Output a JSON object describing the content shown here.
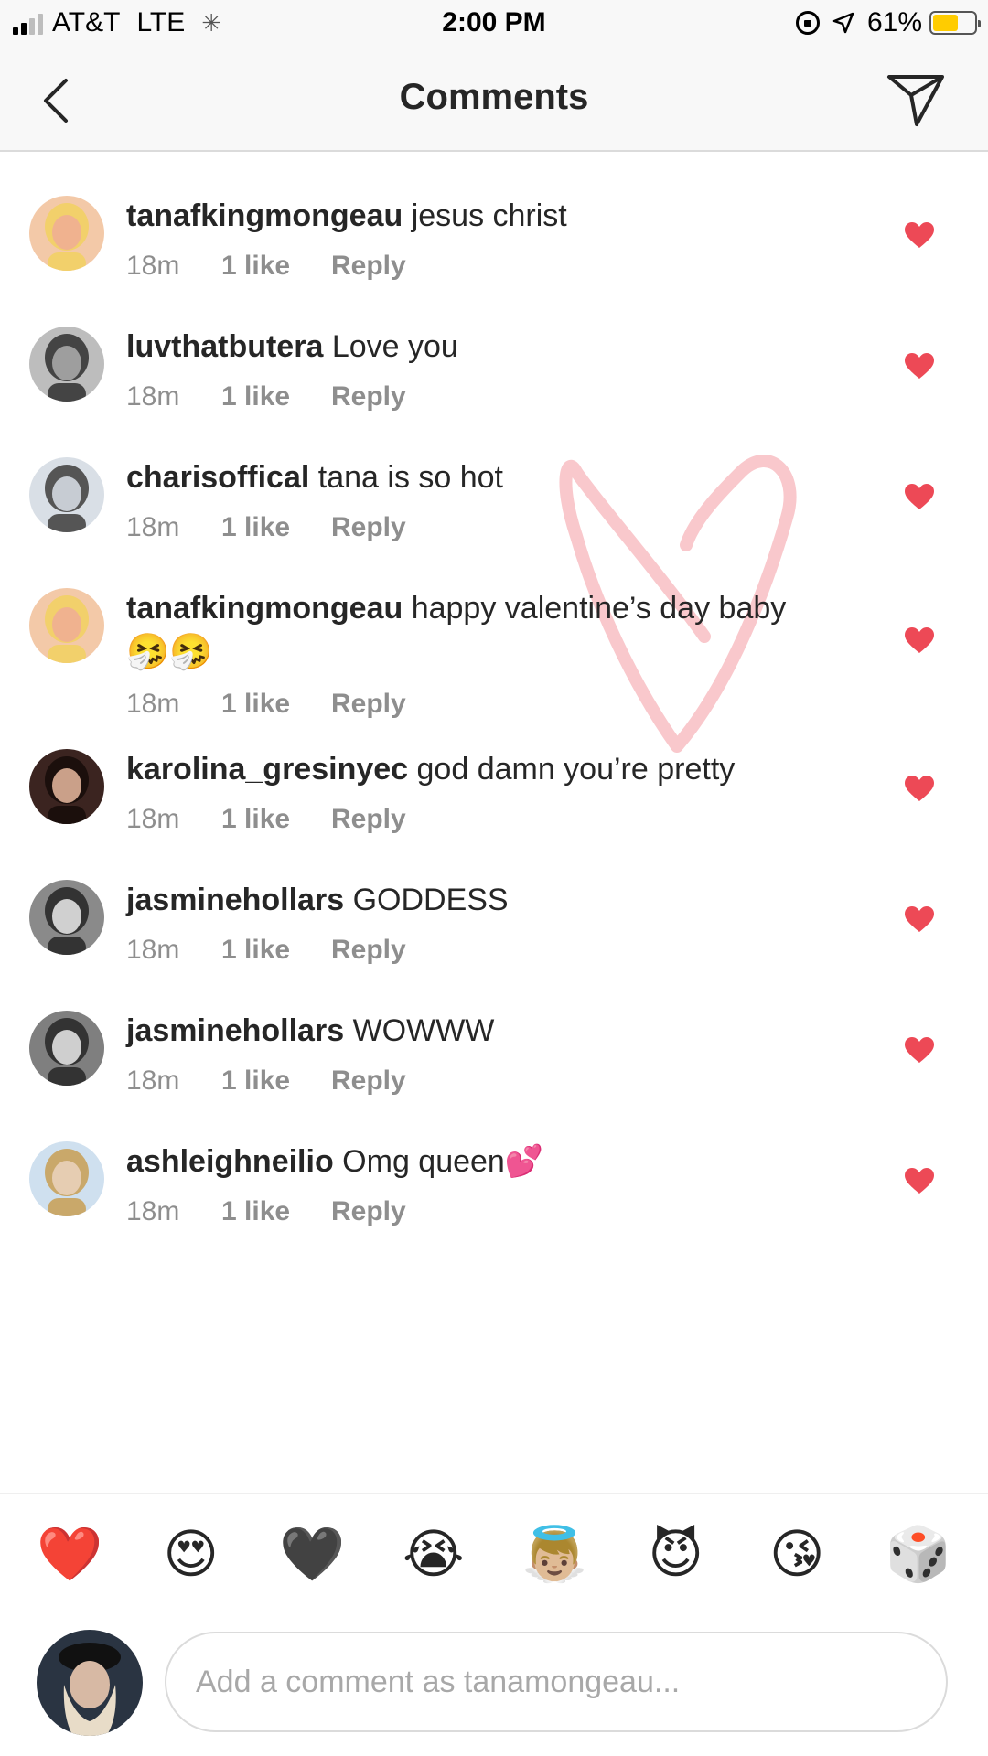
{
  "status_bar": {
    "carrier": "AT&T",
    "network": "LTE",
    "time": "2:00 PM",
    "battery": "61%",
    "battery_level": 0.61,
    "battery_color": "#ffcc00"
  },
  "header": {
    "title": "Comments",
    "back_icon": "chevron-left-icon",
    "send_icon": "paper-plane-icon"
  },
  "comments": [
    {
      "username": "tanafkingmongeau",
      "text": "jesus christ",
      "emoji": "",
      "time": "18m",
      "likes": "1 like",
      "reply": "Reply",
      "liked": true
    },
    {
      "username": "luvthatbutera",
      "text": "Love you",
      "emoji": "",
      "time": "18m",
      "likes": "1 like",
      "reply": "Reply",
      "liked": true
    },
    {
      "username": "charisoffical",
      "text": "tana is so hot",
      "emoji": "",
      "time": "18m",
      "likes": "1 like",
      "reply": "Reply",
      "liked": true
    },
    {
      "username": "tanafkingmongeau",
      "text": "happy valentine’s day baby",
      "emoji": "🤧🤧",
      "time": "18m",
      "likes": "1 like",
      "reply": "Reply",
      "liked": true
    },
    {
      "username": "karolina_gresinyec",
      "text": "god damn you’re pretty",
      "emoji": "",
      "time": "18m",
      "likes": "1 like",
      "reply": "Reply",
      "liked": true
    },
    {
      "username": "jasminehollars",
      "text": "GODDESS",
      "emoji": "",
      "time": "18m",
      "likes": "1 like",
      "reply": "Reply",
      "liked": true
    },
    {
      "username": "jasminehollars",
      "text": "WOWWW",
      "emoji": "",
      "time": "18m",
      "likes": "1 like",
      "reply": "Reply",
      "liked": true
    },
    {
      "username": "ashleighneilio",
      "text": "Omg queen💕",
      "emoji": "",
      "time": "18m",
      "likes": "1 like",
      "reply": "Reply",
      "liked": true
    }
  ],
  "quick_emojis": [
    "❤️",
    "😍",
    "🖤",
    "😭",
    "👼🏼",
    "😈",
    "😘",
    "🎲"
  ],
  "composer": {
    "placeholder": "Add a comment as tanamongeau..."
  },
  "colors": {
    "like_red": "#ed4956",
    "secondary_text": "#8e8e8e",
    "watermark_pink": "#f9c8cc"
  }
}
